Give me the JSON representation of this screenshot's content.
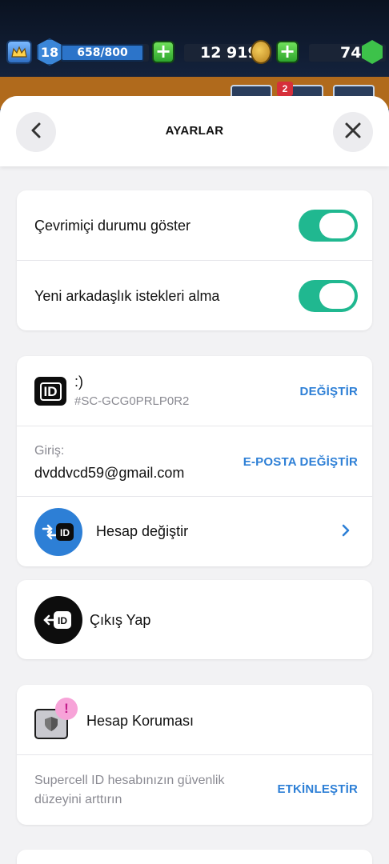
{
  "hud": {
    "level": "18",
    "xp": "658/800",
    "gold": "12 919",
    "gems": "74",
    "notification_count": "2"
  },
  "header": {
    "title": "AYARLAR"
  },
  "privacy": {
    "online_status_label": "Çevrimiçi durumu göster",
    "online_status_on": true,
    "friend_requests_label": "Yeni arkadaşlık istekleri alma",
    "friend_requests_on": true
  },
  "account": {
    "id_badge": "ID",
    "name": ":)",
    "tag": "#SC-GCG0PRLP0R2",
    "change_label": "DEĞİŞTİR",
    "login_label": "Giriş:",
    "email": "dvddvcd59@gmail.com",
    "email_change_label": "E-POSTA DEĞİŞTİR",
    "switch_label": "Hesap değiştir"
  },
  "logout": {
    "label": "Çıkış Yap"
  },
  "protection": {
    "title": "Hesap Koruması",
    "description": "Supercell ID hesabınızın güvenlik düzeyini arttırın",
    "enable_label": "ETKİNLEŞTİR"
  },
  "colors": {
    "toggle_on": "#20b890",
    "link": "#2d7fd6",
    "switch_icon_bg": "#2d7fd6"
  }
}
